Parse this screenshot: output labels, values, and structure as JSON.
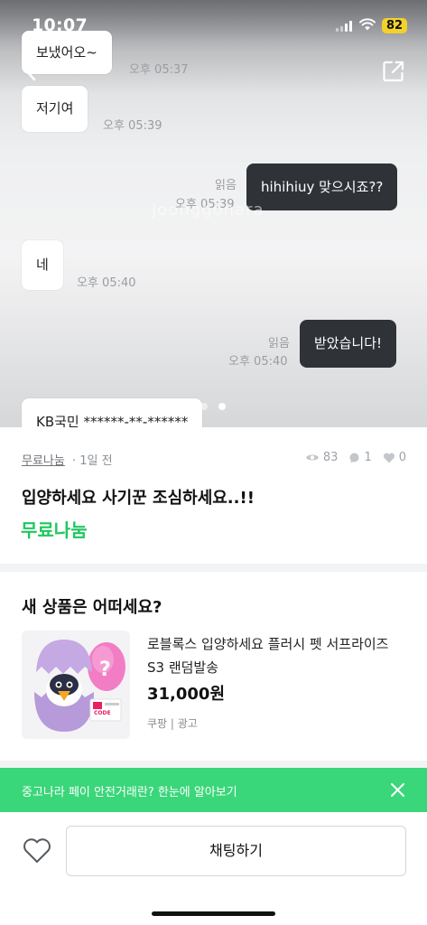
{
  "status_bar": {
    "time": "10:07",
    "battery": "82"
  },
  "chat_screenshot": {
    "watermark": "Joonggonara",
    "messages": [
      {
        "text": "보냈어오~",
        "time": "오후 05:37"
      },
      {
        "text": "저기여",
        "time": "오후 05:39"
      },
      {
        "text": "hihihiuy 맞으시죠??",
        "time": "오후 05:39",
        "read": "읽음"
      },
      {
        "text": "네",
        "time": "오후 05:40"
      },
      {
        "text": "받았습니다!",
        "time": "오후 05:40",
        "read": "읽음"
      },
      {
        "text": "KB국민 ******-**-******"
      }
    ],
    "page_indicator": {
      "current": 2,
      "total": 2
    }
  },
  "post": {
    "category": "무료나눔",
    "time_ago": "1일 전",
    "views": "83",
    "chats": "1",
    "likes": "0",
    "title": "입양하세요 사기꾼 조심하세요..!!",
    "price": "무료나눔"
  },
  "recommend": {
    "title": "새 상품은 어떠세요?",
    "product": {
      "name": "로블록스 입양하세요 플러시 펫 서프라이즈 S3 랜덤발송",
      "price": "31,000원",
      "seller": "쿠팡 | 광고",
      "badge": "CODE"
    }
  },
  "pay_banner": {
    "text": "중고나라 페이 안전거래란? 한눈에 알아보기"
  },
  "bottom_bar": {
    "chat_button": "채팅하기"
  },
  "colors": {
    "accent_green": "#1ec85e",
    "banner_green": "#3ad67a",
    "bubble_dark": "#2f3338",
    "battery": "#f3d12b"
  }
}
